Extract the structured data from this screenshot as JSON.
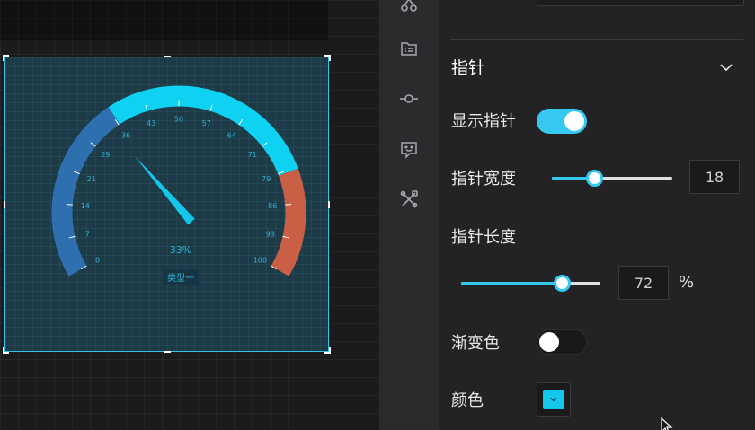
{
  "gauge": {
    "min": 0,
    "max": 100,
    "value": 33,
    "value_label": "33%",
    "type_label": "类型一",
    "tick_labels": [
      "0",
      "7",
      "14",
      "21",
      "29",
      "36",
      "43",
      "50",
      "57",
      "64",
      "71",
      "79",
      "86",
      "93",
      "100"
    ],
    "bands": [
      {
        "from": 0,
        "to": 36,
        "color": "#2e6fb0"
      },
      {
        "from": 36,
        "to": 79,
        "color": "#0fd2f2"
      },
      {
        "from": 79,
        "to": 100,
        "color": "#c95f44"
      }
    ],
    "pointer_color": "#12c7ea",
    "label_color": "#2fb3d8"
  },
  "toolbar": {
    "items": [
      {
        "icon": "link-nodes-icon"
      },
      {
        "icon": "list-doc-icon"
      },
      {
        "icon": "commit-node-icon"
      },
      {
        "icon": "chat-face-icon"
      },
      {
        "icon": "tools-icon"
      }
    ]
  },
  "panel": {
    "section_title": "指针",
    "show_pointer": {
      "label": "显示指针",
      "enabled": true
    },
    "pointer_width": {
      "label": "指针宽度",
      "value": "18",
      "slider_fraction": 0.35
    },
    "pointer_length": {
      "label": "指针长度",
      "value": "72",
      "unit": "%",
      "slider_fraction": 0.72
    },
    "gradient": {
      "label": "渐变色",
      "enabled": false
    },
    "color": {
      "label": "颜色",
      "value": "#12c7ea"
    }
  },
  "colors": {
    "accent": "#35c8f0",
    "selection_border": "#39c4e6"
  }
}
